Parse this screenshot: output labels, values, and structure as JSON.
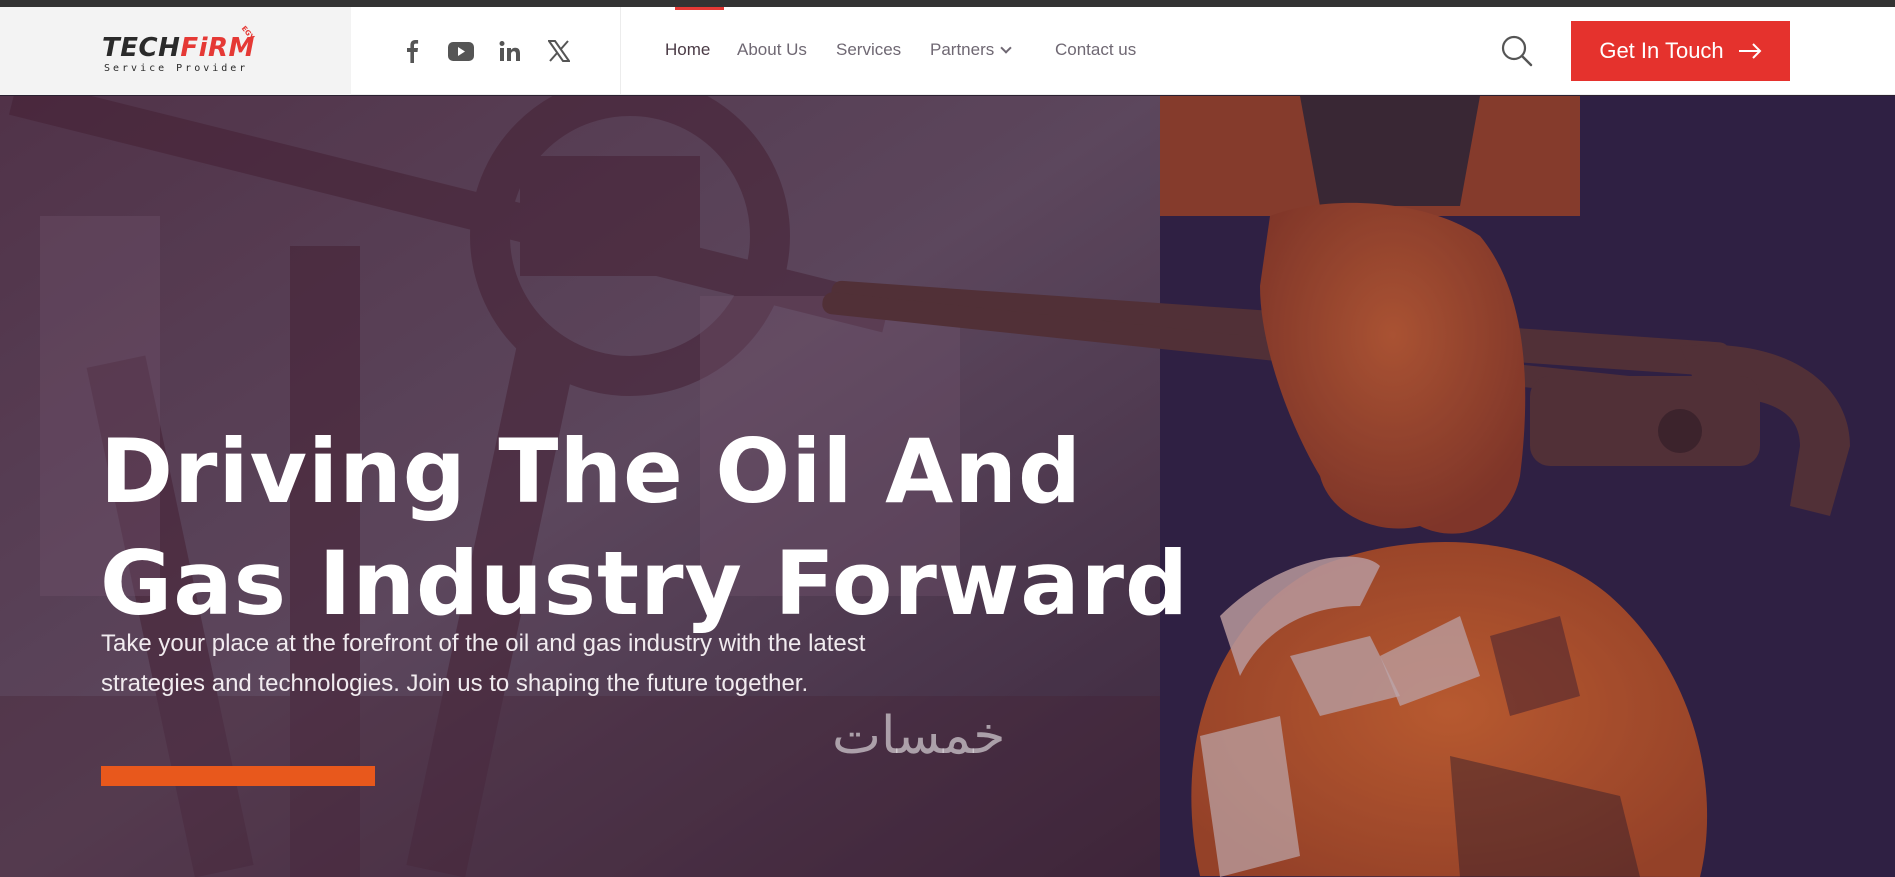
{
  "header": {
    "logo": {
      "name_dark": "TECH",
      "name_accent": "FiRM",
      "tagline": "Service Provider",
      "mark": "EGY"
    },
    "social": [
      {
        "icon": "facebook-icon"
      },
      {
        "icon": "youtube-icon"
      },
      {
        "icon": "linkedin-icon"
      },
      {
        "icon": "x-icon"
      }
    ],
    "nav": [
      {
        "label": "Home",
        "active": true
      },
      {
        "label": "About Us"
      },
      {
        "label": "Services"
      },
      {
        "label": "Partners",
        "has_dropdown": true
      },
      {
        "label": "Contact us"
      }
    ],
    "search_icon": "search-icon",
    "cta": {
      "label": "Get In Touch",
      "icon": "arrow-right-icon"
    }
  },
  "hero": {
    "title_line1": "Driving The Oil And",
    "title_line2": "Gas Industry Forward",
    "description": "Take your place at the forefront of the oil and gas industry with the latest strategies and technologies. Join us to shaping the future together.",
    "watermark": "خمسات"
  },
  "colors": {
    "accent": "#e5322d",
    "hero_button": "#e8581c",
    "nav_text": "#6f6873",
    "overlay": "#3b2a3e"
  }
}
